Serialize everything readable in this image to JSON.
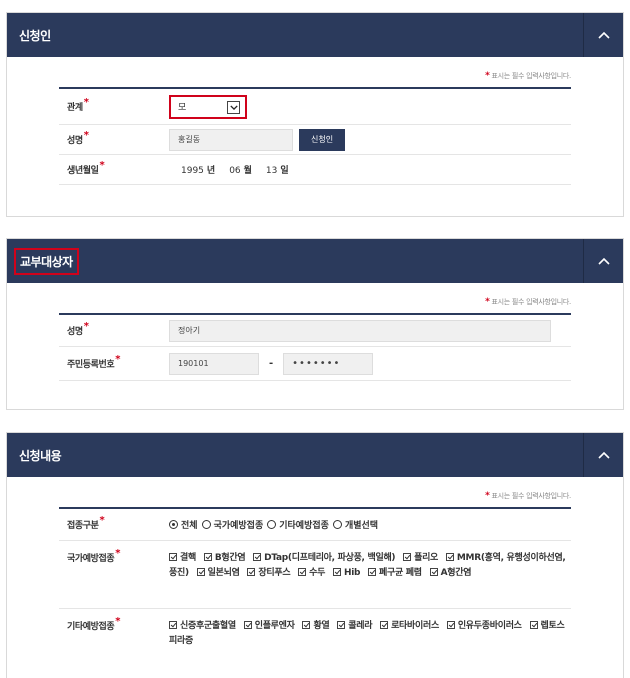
{
  "required_notice": "표시는 필수 입력사항입니다.",
  "required_star": "*",
  "applicant": {
    "title": "신청인",
    "relation_label": "관계",
    "relation_value": "모",
    "name_label": "성명",
    "name_value": "홍길동",
    "applicant_button": "신청인",
    "birth_label": "생년월일",
    "birth_year": "1995",
    "birth_year_unit": "년",
    "birth_month": "06",
    "birth_month_unit": "월",
    "birth_day": "13",
    "birth_day_unit": "일"
  },
  "recipient": {
    "title": "교부대상자",
    "name_label": "성명",
    "name_value": "정아기",
    "rrn_label": "주민등록번호",
    "rrn_front": "190101",
    "rrn_dash": "-",
    "rrn_back": "•••••••"
  },
  "details": {
    "title": "신청내용",
    "vaccine_type_label": "접종구분",
    "vaccine_type_options": [
      {
        "label": "전체",
        "checked": true
      },
      {
        "label": "국가예방접종",
        "checked": false
      },
      {
        "label": "기타예방접종",
        "checked": false
      },
      {
        "label": "개별선택",
        "checked": false
      }
    ],
    "national_label": "국가예방접종",
    "national_items": [
      "결핵",
      "B형간염",
      "DTap(디프테리아, 파상풍, 백일해)",
      "폴리오",
      "MMR(홍역, 유행성이하선염, 풍진)",
      "일본뇌염",
      "장티푸스",
      "수두",
      "Hib",
      "폐구균 폐렴",
      "A형간염"
    ],
    "other_label": "기타예방접종",
    "other_items": [
      "신증후군출혈열",
      "인플루엔자",
      "황열",
      "콜레라",
      "로타바이러스",
      "인유두종바이러스",
      "렙토스피라증"
    ]
  },
  "icons": {
    "collapse": "chevron-up-icon",
    "dropdown": "chevron-down-icon"
  },
  "colors": {
    "header_bg": "#2b3a5c",
    "required": "#d0021b",
    "highlight_border": "#d0021b"
  }
}
